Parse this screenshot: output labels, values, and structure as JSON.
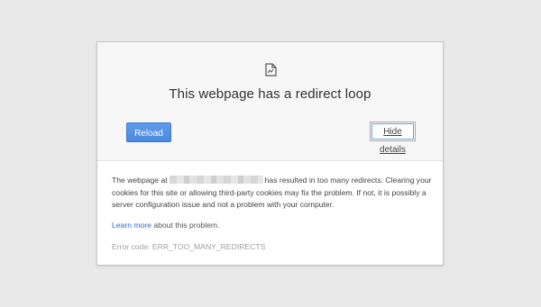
{
  "page": {
    "title": "This webpage has a redirect loop",
    "icon": "document-error-icon"
  },
  "buttons": {
    "reload": "Reload",
    "hide_details": "Hide details"
  },
  "details": {
    "prefix": "The webpage at",
    "suffix": "has resulted in too many redirects. Clearing your cookies for this site or allowing third-party cookies may fix the problem. If not, it is possibly a server configuration issue and not a problem with your computer.",
    "learn_more": "Learn more",
    "learn_more_suffix": " about this problem.",
    "error_code": "Error code: ERR_TOO_MANY_REDIRECTS"
  },
  "colors": {
    "accent": "#4a89dc",
    "link": "#2a6ad6",
    "background": "#e9e9e9"
  }
}
